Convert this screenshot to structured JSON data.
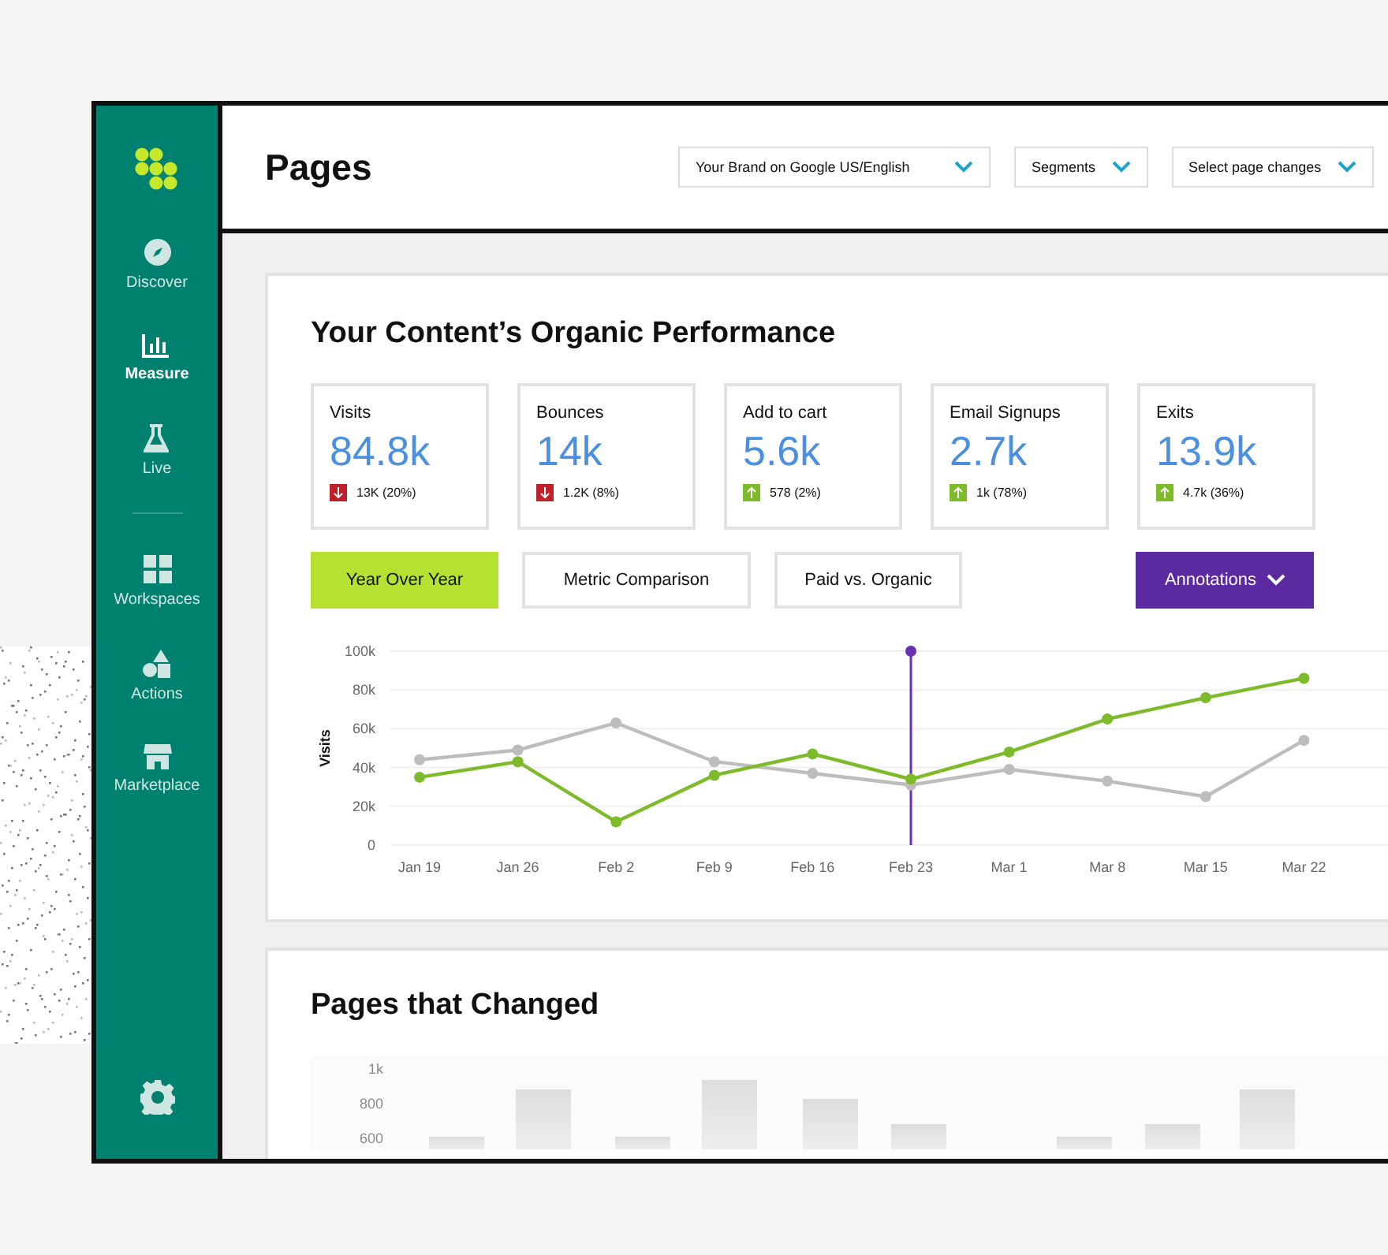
{
  "sidebar": {
    "items": [
      {
        "label": "Discover",
        "selected": false
      },
      {
        "label": "Measure",
        "selected": true
      },
      {
        "label": "Live",
        "selected": false
      },
      {
        "label": "Workspaces",
        "selected": false
      },
      {
        "label": "Actions",
        "selected": false
      },
      {
        "label": "Marketplace",
        "selected": false
      }
    ]
  },
  "header": {
    "title": "Pages",
    "dropdowns": [
      "Your Brand on Google US/English",
      "Segments",
      "Select page changes"
    ]
  },
  "performance": {
    "title": "Your Content’s Organic Performance",
    "metrics": [
      {
        "label": "Visits",
        "value": "84.8k",
        "change": "13K (20%)",
        "kind": "down"
      },
      {
        "label": "Bounces",
        "value": "14k",
        "change": "1.2K (8%)",
        "kind": "down"
      },
      {
        "label": "Add to cart",
        "value": "5.6k",
        "change": "578 (2%)",
        "kind": "up"
      },
      {
        "label": "Email Signups",
        "value": "2.7k",
        "change": "1k (78%)",
        "kind": "up"
      },
      {
        "label": "Exits",
        "value": "13.9k",
        "change": "4.7k (36%)",
        "kind": "up"
      }
    ],
    "tabs": [
      {
        "label": "Year Over Year",
        "selected": true
      },
      {
        "label": "Metric Comparison",
        "selected": false
      },
      {
        "label": "Paid vs. Organic",
        "selected": false
      }
    ],
    "annotations_button": "Annotations",
    "chart_data": {
      "type": "line",
      "ylabel": "Visits",
      "categories": [
        "Jan 19",
        "Jan 26",
        "Feb 2",
        "Feb 9",
        "Feb 16",
        "Feb 23",
        "Mar 1",
        "Mar 8",
        "Mar 15",
        "Mar 22"
      ],
      "grid": true,
      "series": [
        {
          "color": "#7dbb2a",
          "marker": "o",
          "values": [
            35000,
            43000,
            12000,
            36000,
            47000,
            34000,
            48000,
            65000,
            76000,
            86000
          ]
        },
        {
          "color": "#bdbdbd",
          "marker": "o",
          "values": [
            44000,
            49000,
            63000,
            43000,
            37000,
            31000,
            39000,
            33000,
            25000,
            54000
          ]
        }
      ],
      "ylim": [
        0,
        100000
      ],
      "yticks": [
        {
          "value": 0,
          "label": "0"
        },
        {
          "value": 20000,
          "label": "20k"
        },
        {
          "value": 40000,
          "label": "40k"
        },
        {
          "value": 60000,
          "label": "60k"
        },
        {
          "value": 80000,
          "label": "80k"
        },
        {
          "value": 100000,
          "label": "100k"
        }
      ],
      "ref_lines": [
        {
          "axis": "x",
          "value": "Feb 23",
          "color": "#6b2fb3"
        }
      ]
    }
  },
  "pages_changed": {
    "title": "Pages that Changed",
    "y_labels": [
      "1k",
      "800",
      "600"
    ]
  }
}
